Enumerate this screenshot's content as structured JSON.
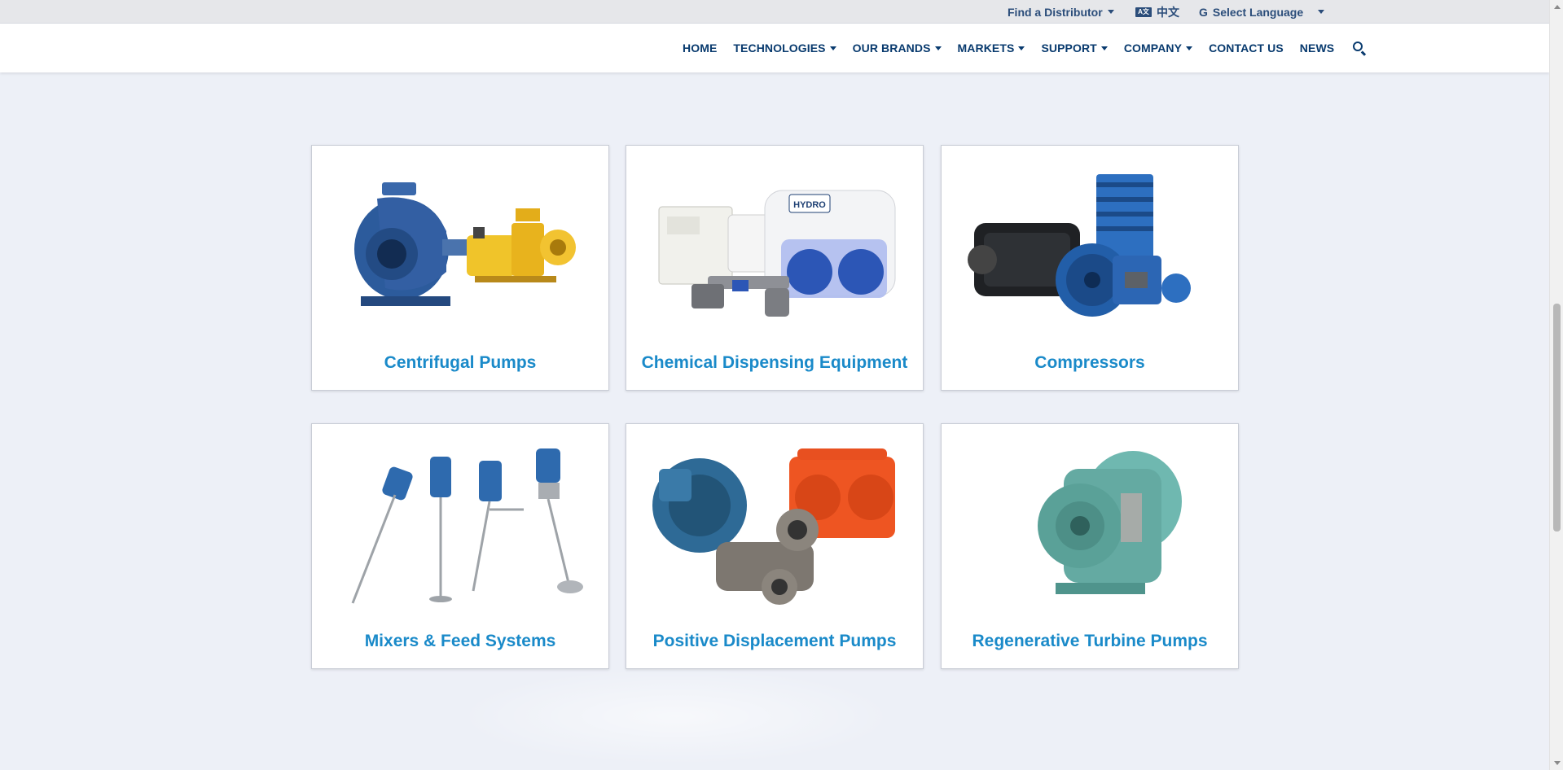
{
  "topbar": {
    "distributor_label": "Find a Distributor",
    "chinese_label": "中文",
    "chinese_icon": "translate-icon",
    "language_label": "Select Language",
    "language_icon": "google-g-icon"
  },
  "nav": {
    "items": [
      {
        "label": "HOME",
        "dropdown": false
      },
      {
        "label": "TECHNOLOGIES",
        "dropdown": true
      },
      {
        "label": "OUR BRANDS",
        "dropdown": true
      },
      {
        "label": "MARKETS",
        "dropdown": true
      },
      {
        "label": "SUPPORT",
        "dropdown": true
      },
      {
        "label": "COMPANY",
        "dropdown": true
      },
      {
        "label": "CONTACT US",
        "dropdown": false
      },
      {
        "label": "NEWS",
        "dropdown": false
      }
    ],
    "search_icon": "search-icon"
  },
  "cards": [
    {
      "label": "Centrifugal Pumps",
      "image": "centrifugal-pumps-image"
    },
    {
      "label": "Chemical Dispensing Equipment",
      "image": "chemical-dispensing-image",
      "image_text": "HYDRO"
    },
    {
      "label": "Compressors",
      "image": "compressors-image"
    },
    {
      "label": "Mixers & Feed Systems",
      "image": "mixers-image"
    },
    {
      "label": "Positive Displacement Pumps",
      "image": "pd-pumps-image"
    },
    {
      "label": "Regenerative Turbine Pumps",
      "image": "turbine-pumps-image"
    }
  ],
  "colors": {
    "nav_text": "#083a6e",
    "card_label": "#1a8ac9",
    "page_bg": "#edf0f7"
  }
}
